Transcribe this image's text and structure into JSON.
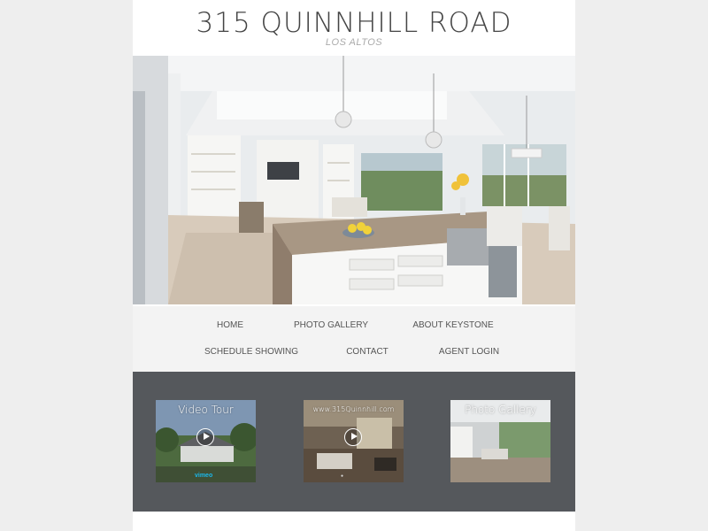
{
  "header": {
    "title": "315 QUINNHILL ROAD",
    "subtitle": "LOS ALTOS"
  },
  "hero": {
    "image": "kitchen-interior-photo"
  },
  "nav": {
    "items": [
      {
        "label": "HOME"
      },
      {
        "label": "PHOTO GALLERY"
      },
      {
        "label": "ABOUT KEYSTONE"
      },
      {
        "label": "SCHEDULE SHOWING"
      },
      {
        "label": "CONTACT"
      },
      {
        "label": "AGENT LOGIN"
      }
    ]
  },
  "media": {
    "video_tour": {
      "label": "Video Tour",
      "badge": "vimeo"
    },
    "site_video": {
      "label": "www.315Quinnhill.com"
    },
    "photo_gallery": {
      "label": "Photo Gallery"
    }
  },
  "colors": {
    "page_bg": "#eeeeee",
    "content_bg": "#ffffff",
    "nav_bg": "#f3f3f3",
    "media_band_bg": "#55585c",
    "title_text": "#444444"
  }
}
